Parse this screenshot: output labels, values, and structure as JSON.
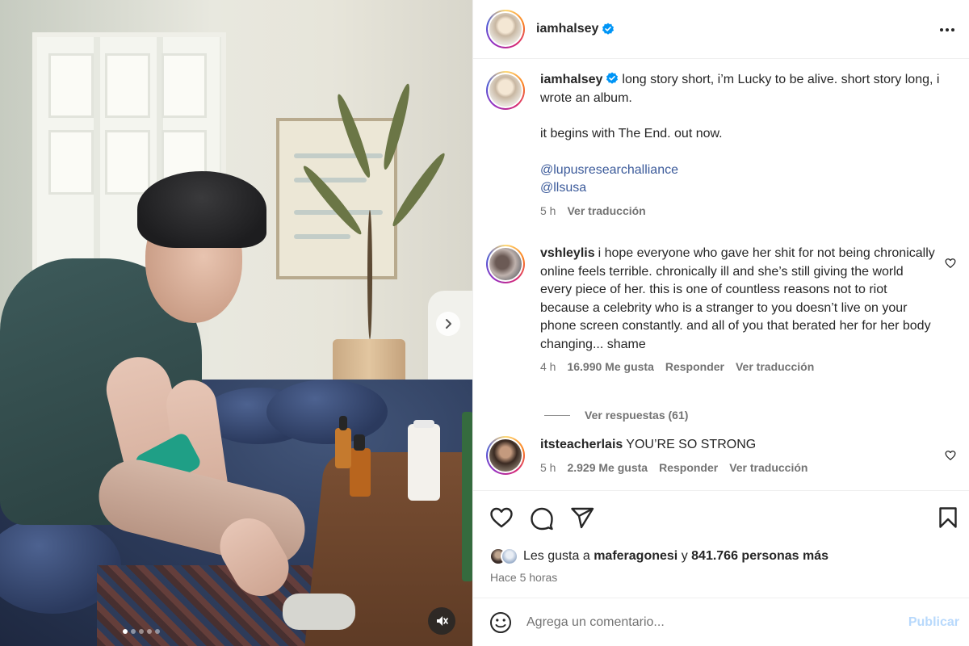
{
  "media": {
    "carousel_dots": 5,
    "active_dot": 1
  },
  "header": {
    "username": "iamhalsey",
    "verified": true,
    "more_icon": "more-horizontal-icon"
  },
  "caption": {
    "username": "iamhalsey",
    "line1": "long story short, i’m Lucky to be alive. short story long, i wrote an album.",
    "line2": "it begins with The End. out now.",
    "mention1": "@lupusresearchalliance",
    "mention2": "@llsusa",
    "time": "5 h",
    "translate": "Ver traducción"
  },
  "comments": [
    {
      "username": "vshleylis",
      "text": "i hope everyone who gave her shit for not being chronically online feels terrible. chronically ill and she’s still giving the world every piece of her. this is one of countless reasons not to riot because a celebrity who is a stranger to you doesn’t live on your phone screen constantly. and all of you that berated her for her body changing... shame",
      "time": "4 h",
      "likes": "16.990 Me gusta",
      "reply": "Responder",
      "translate": "Ver traducción",
      "view_replies": "Ver respuestas (61)"
    },
    {
      "username": "itsteacherlais",
      "text": "YOU’RE SO STRONG",
      "time": "5 h",
      "likes": "2.929 Me gusta",
      "reply": "Responder",
      "translate": "Ver traducción"
    }
  ],
  "likes": {
    "prefix": "Les gusta a",
    "user": "maferagonesi",
    "connector": "y",
    "count": "841.766 personas más"
  },
  "posted": "Hace 5 horas",
  "composer": {
    "placeholder": "Agrega un comentario...",
    "publish": "Publicar"
  },
  "colors": {
    "verified": "#0095f6",
    "link": "#3b5a9a",
    "publish_disabled": "#b8d9fc"
  }
}
